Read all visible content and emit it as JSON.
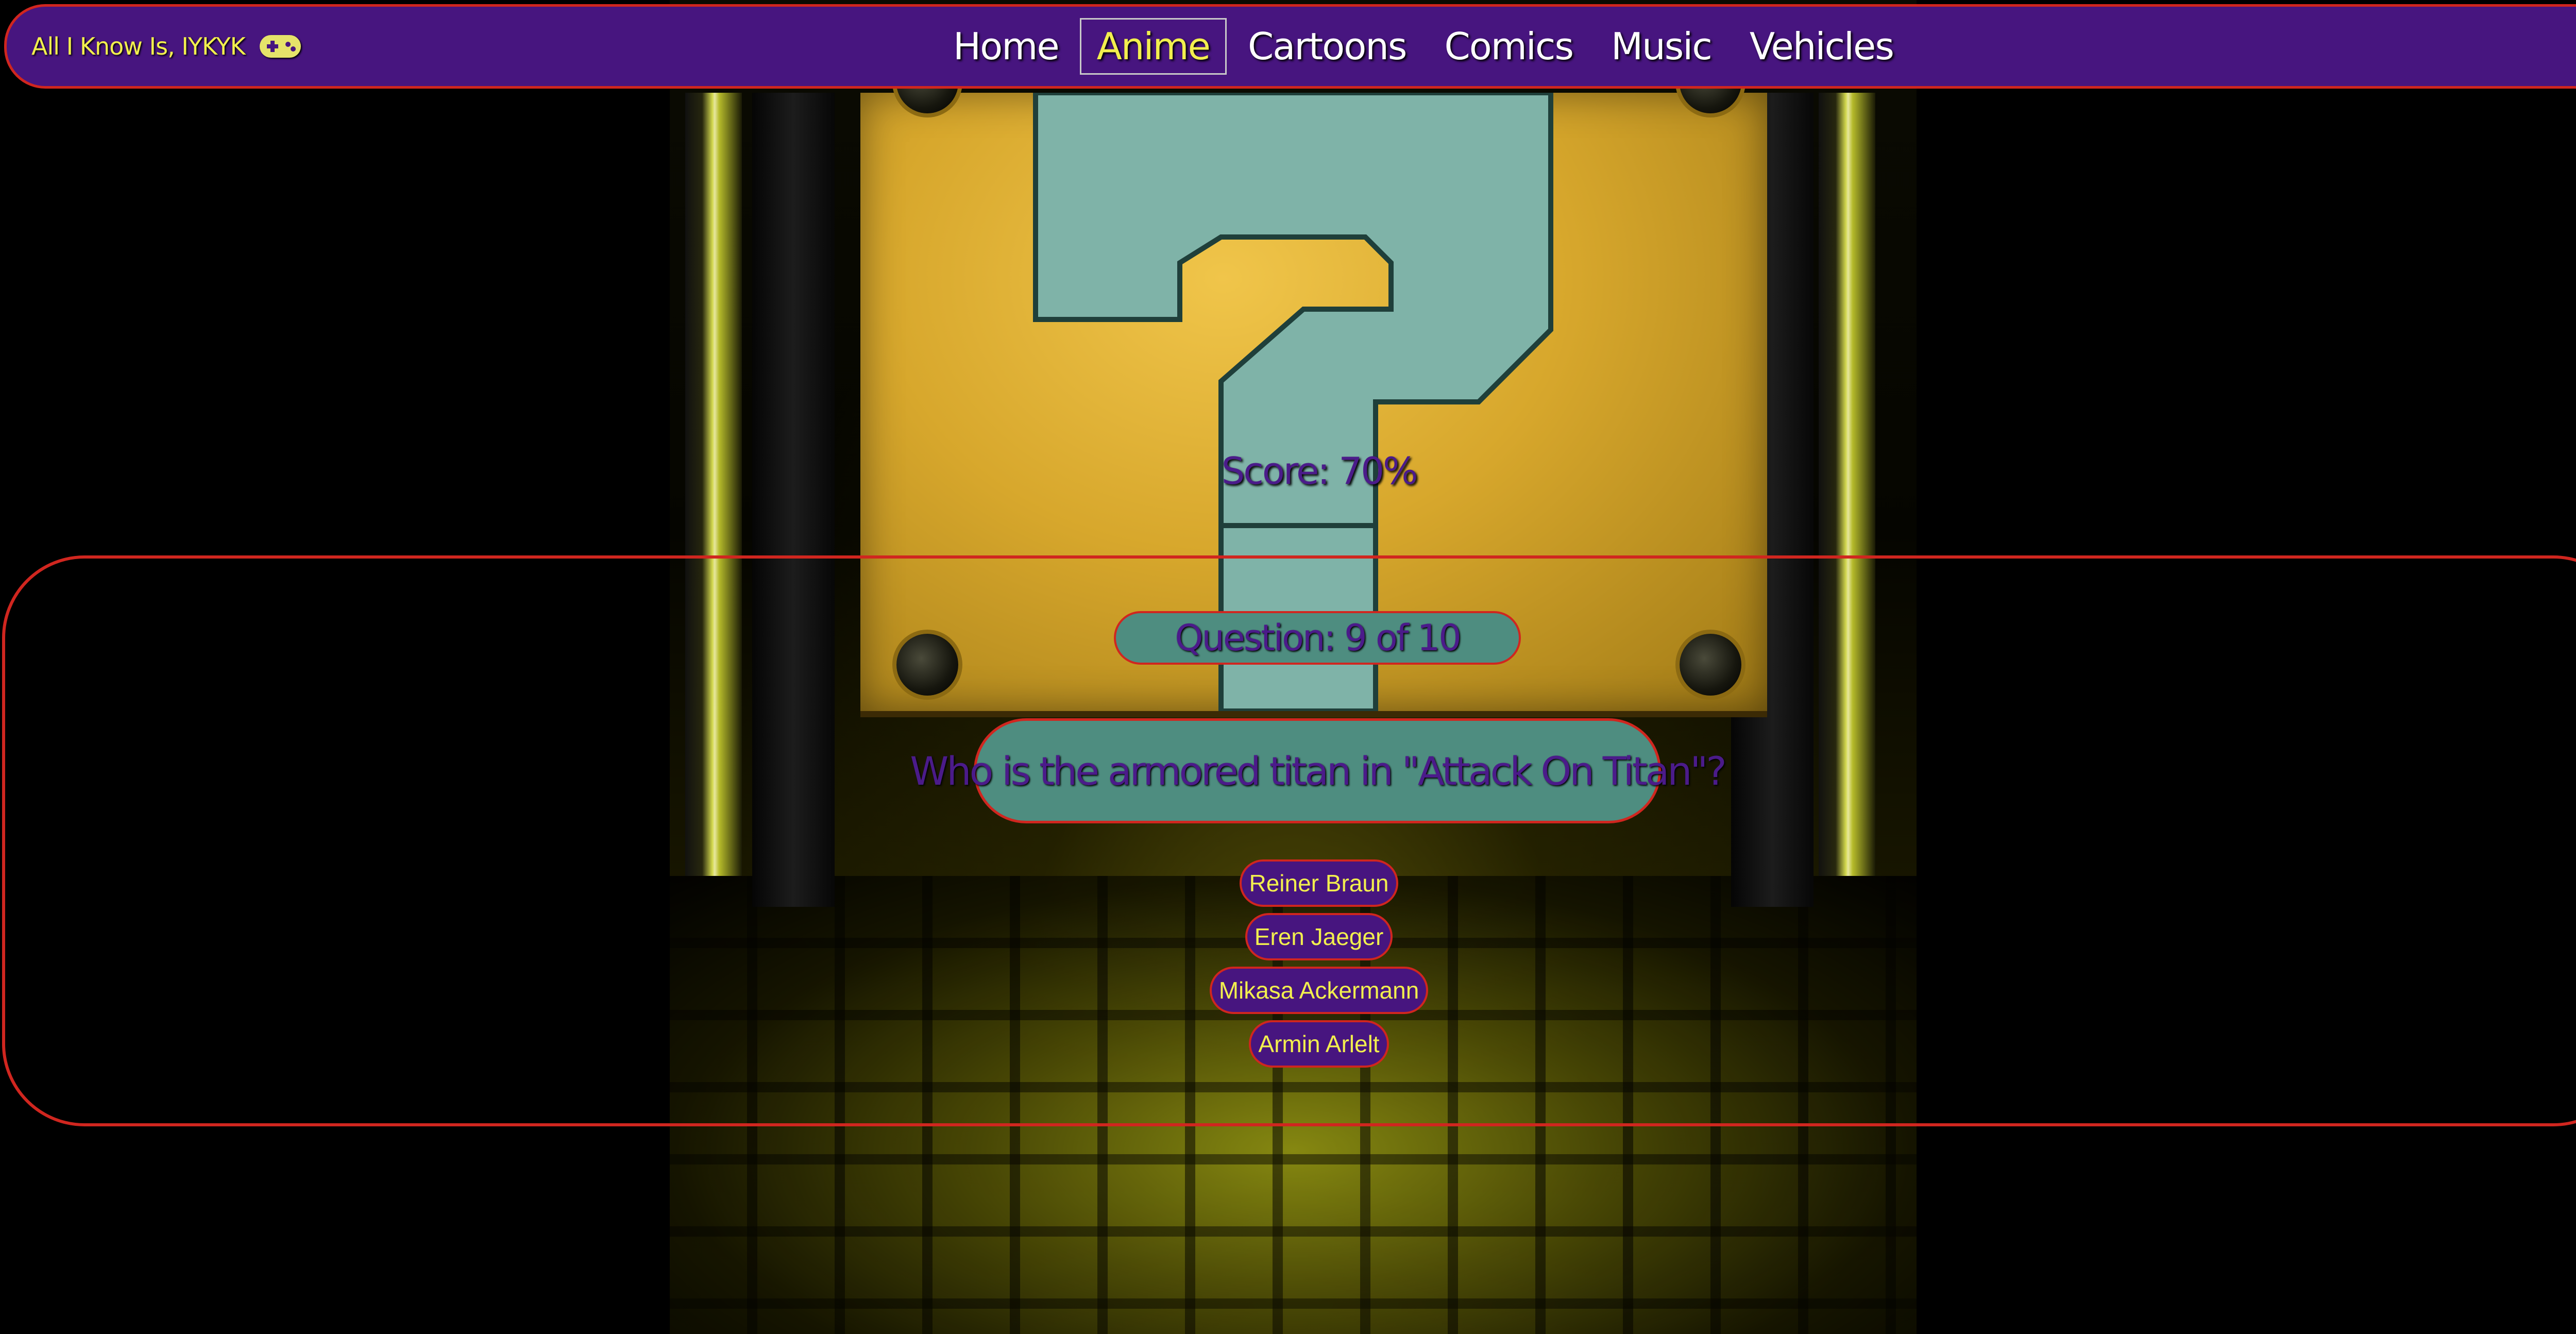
{
  "brand": {
    "title": "All I Know Is, IYKYK",
    "icon": "gamepad-icon"
  },
  "nav": {
    "items": [
      {
        "label": "Home",
        "active": false
      },
      {
        "label": "Anime",
        "active": true
      },
      {
        "label": "Cartoons",
        "active": false
      },
      {
        "label": "Comics",
        "active": false
      },
      {
        "label": "Music",
        "active": false
      },
      {
        "label": "Vehicles",
        "active": false
      }
    ]
  },
  "quiz": {
    "score_text": "Score: 70%",
    "counter_text": "Question: 9 of 10",
    "question": "Who is the armored titan in \"Attack On Titan\"?",
    "answers": [
      "Reiner Braun",
      "Eren Jaeger",
      "Mikasa Ackermann",
      "Armin Arlelt"
    ]
  },
  "colors": {
    "nav_background": "#47157f",
    "border": "#d0261f",
    "accent_yellow": "#f2ef4e",
    "panel_teal": "#4e8d80",
    "text_purple": "#4b1b8a"
  },
  "background": {
    "image": "question-block-corridor"
  }
}
